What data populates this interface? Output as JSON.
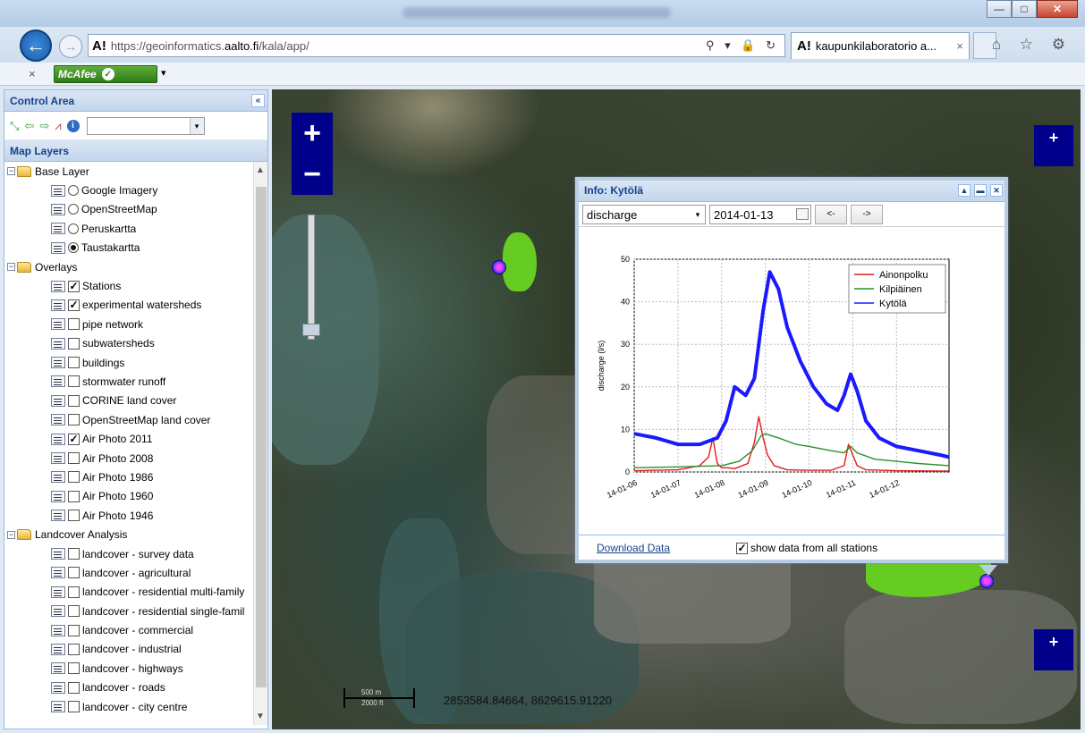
{
  "browser": {
    "url_prefix": "https://geoinformatics.",
    "url_domain": "aalto.fi",
    "url_path": "/kala/app/",
    "addr_logo": "A!",
    "tab_logo": "A!",
    "tab_title": "kaupunkilaboratorio a...",
    "tab_close": "×",
    "addr_tools": "⚲ ▾ 🔒 ↻",
    "right_icons": "⌂ ☆ ⚙",
    "win_min": "—",
    "win_max": "□",
    "win_close": "✕",
    "back_glyph": "←",
    "fwd_glyph": "→"
  },
  "toolbar": {
    "close_glyph": "×",
    "mcafee_label": "McAfee",
    "mcafee_check": "✓",
    "dropdown_glyph": "▾"
  },
  "control_area": {
    "title": "Control Area",
    "collapse_glyph": "«",
    "dropdown_glyph": "▾"
  },
  "map_layers": {
    "title": "Map Layers",
    "groups": [
      {
        "name": "Base Layer",
        "items": [
          "Google Imagery",
          "OpenStreetMap",
          "Peruskartta",
          "Taustakartta"
        ]
      },
      {
        "name": "Overlays",
        "items": [
          "Stations",
          "experimental watersheds",
          "pipe network",
          "subwatersheds",
          "buildings",
          "stormwater runoff",
          "CORINE land cover",
          "OpenStreetMap land cover",
          "Air Photo 2011",
          "Air Photo 2008",
          "Air Photo 1986",
          "Air Photo 1960",
          "Air Photo 1946"
        ]
      },
      {
        "name": "Landcover Analysis",
        "items": [
          "landcover - survey data",
          "landcover - agricultural",
          "landcover - residential multi-family",
          "landcover - residential single-famil",
          "landcover - commercial",
          "landcover - industrial",
          "landcover - highways",
          "landcover - roads",
          "landcover - city centre"
        ]
      }
    ],
    "expander_glyph": "−",
    "check_glyph": "✓"
  },
  "map": {
    "zoom_in": "+",
    "zoom_out": "−",
    "panel_plus": "+",
    "scale_top": "500 m",
    "scale_bottom": "2000 ft",
    "coordinates": "2853584.84664, 8629615.91220"
  },
  "info": {
    "title": "Info: Kytölä",
    "variable": "discharge",
    "date": "2014-01-13",
    "prev_label": "<-",
    "next_label": "->",
    "download_label": "Download Data",
    "show_all_label": "show data from all stations",
    "show_all_checked": true,
    "head_buttons": [
      "▲",
      "▬",
      "✕"
    ]
  },
  "chart_data": {
    "type": "line",
    "ylabel": "discharge (l/s)",
    "xlabel": "",
    "ylim": [
      0,
      50
    ],
    "y_ticks": [
      0,
      10,
      20,
      30,
      40,
      50
    ],
    "x_ticks": [
      "14-01-06",
      "14-01-07",
      "14-01-08",
      "14-01-09",
      "14-01-10",
      "14-01-11",
      "14-01-12"
    ],
    "xlim_days": [
      0,
      7.2
    ],
    "legend_position": "top-right",
    "grid": true,
    "series": [
      {
        "name": "Ainonpolku",
        "color": "#e41a1c",
        "x": [
          0,
          1,
          1.5,
          1.7,
          1.8,
          1.9,
          2.0,
          2.1,
          2.3,
          2.6,
          2.75,
          2.85,
          2.95,
          3.05,
          3.2,
          3.5,
          4.0,
          4.5,
          4.8,
          4.9,
          5.0,
          5.1,
          5.3,
          6.0,
          7.0,
          7.2
        ],
        "y": [
          0.3,
          0.5,
          1.5,
          3.5,
          8,
          2,
          1,
          1,
          0.8,
          2,
          7,
          13,
          8,
          4,
          1.5,
          0.5,
          0.4,
          0.4,
          1.5,
          6.5,
          4,
          1.5,
          0.5,
          0.3,
          0.2,
          0.2
        ]
      },
      {
        "name": "Kilpiäinen",
        "color": "#2a8f2a",
        "x": [
          0,
          1,
          2,
          2.4,
          2.7,
          2.9,
          3.0,
          3.3,
          3.7,
          4.0,
          4.5,
          4.8,
          4.95,
          5.1,
          5.5,
          6.0,
          6.5,
          7.2
        ],
        "y": [
          1,
          1.2,
          1.5,
          2.5,
          5,
          8.5,
          9,
          8,
          6.5,
          6,
          5,
          4.5,
          6,
          4.5,
          3,
          2.5,
          2,
          1.5
        ]
      },
      {
        "name": "Kytölä",
        "color": "#1a1aff",
        "x": [
          0,
          0.5,
          1,
          1.5,
          1.9,
          2.1,
          2.3,
          2.55,
          2.75,
          2.95,
          3.1,
          3.3,
          3.5,
          3.8,
          4.1,
          4.4,
          4.65,
          4.8,
          4.95,
          5.1,
          5.3,
          5.6,
          6.0,
          6.5,
          7.0,
          7.2
        ],
        "y": [
          9,
          8,
          6.5,
          6.5,
          8,
          12,
          20,
          18,
          22,
          38,
          47,
          43,
          34,
          26,
          20,
          16,
          14.5,
          18,
          23,
          19,
          12,
          8,
          6,
          5,
          4,
          3.5
        ]
      }
    ]
  }
}
